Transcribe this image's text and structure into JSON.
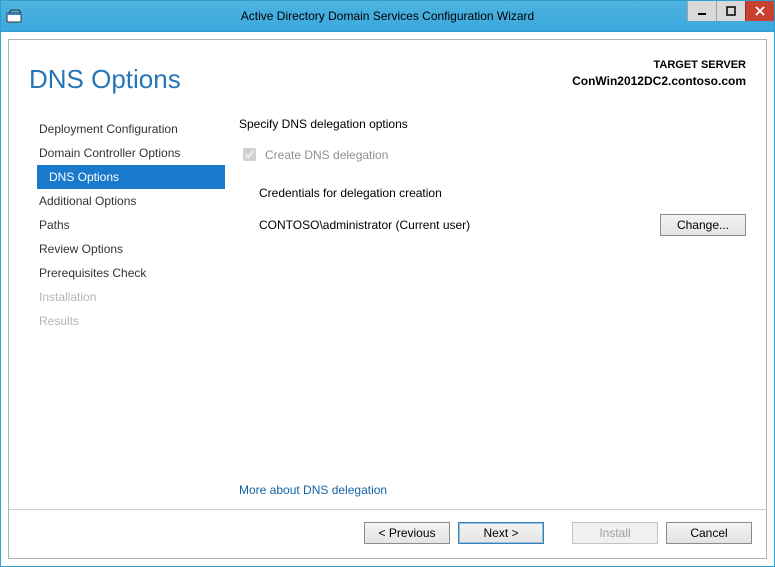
{
  "window": {
    "title": "Active Directory Domain Services Configuration Wizard"
  },
  "header": {
    "page_title": "DNS Options",
    "target_label": "TARGET SERVER",
    "target_server": "ConWin2012DC2.contoso.com"
  },
  "sidebar": {
    "items": [
      {
        "label": "Deployment Configuration",
        "state": "normal"
      },
      {
        "label": "Domain Controller Options",
        "state": "normal"
      },
      {
        "label": "DNS Options",
        "state": "active"
      },
      {
        "label": "Additional Options",
        "state": "normal"
      },
      {
        "label": "Paths",
        "state": "normal"
      },
      {
        "label": "Review Options",
        "state": "normal"
      },
      {
        "label": "Prerequisites Check",
        "state": "normal"
      },
      {
        "label": "Installation",
        "state": "disabled"
      },
      {
        "label": "Results",
        "state": "disabled"
      }
    ]
  },
  "content": {
    "heading": "Specify DNS delegation options",
    "checkbox_label": "Create DNS delegation",
    "checkbox_checked": true,
    "checkbox_disabled": true,
    "credentials_heading": "Credentials for delegation creation",
    "credentials_value": "CONTOSO\\administrator (Current user)",
    "change_button": "Change...",
    "more_link": "More about DNS delegation"
  },
  "footer": {
    "previous": "< Previous",
    "next": "Next >",
    "install": "Install",
    "cancel": "Cancel"
  }
}
